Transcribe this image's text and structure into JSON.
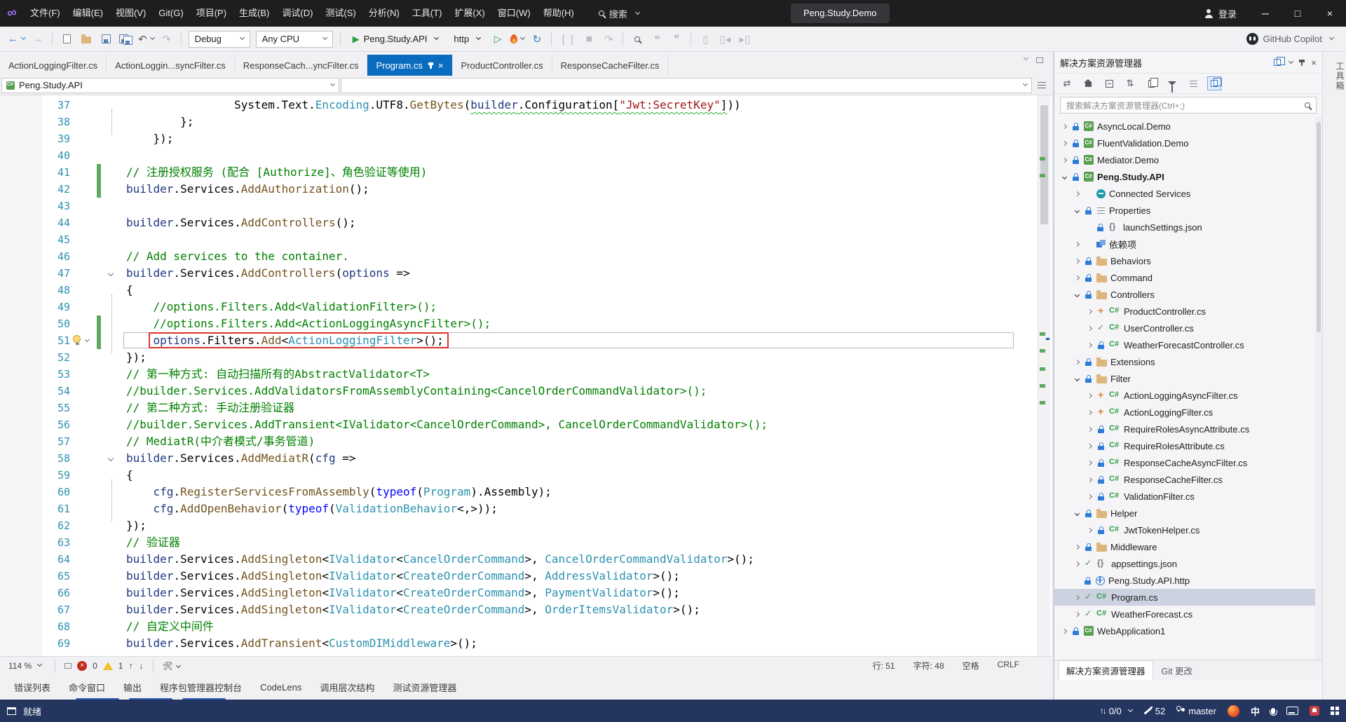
{
  "titlebar": {
    "menus": [
      "文件(F)",
      "编辑(E)",
      "视图(V)",
      "Git(G)",
      "项目(P)",
      "生成(B)",
      "调试(D)",
      "测试(S)",
      "分析(N)",
      "工具(T)",
      "扩展(X)",
      "窗口(W)",
      "帮助(H)"
    ],
    "search_label": "搜索",
    "solution_pill": "Peng.Study.Demo",
    "signin_label": "登录",
    "minimize": "─",
    "maximize": "□",
    "close": "×"
  },
  "toolbar": {
    "config_label": "Debug",
    "platform_label": "Any CPU",
    "run_target": "Peng.Study.API",
    "run_profile": "http",
    "copilot_label": "GitHub Copilot"
  },
  "doc_tabs": [
    {
      "label": "ActionLoggingFilter.cs",
      "active": false
    },
    {
      "label": "ActionLoggin...syncFilter.cs",
      "active": false
    },
    {
      "label": "ResponseCach...yncFilter.cs",
      "active": false
    },
    {
      "label": "Program.cs",
      "active": true
    },
    {
      "label": "ProductController.cs",
      "active": false
    },
    {
      "label": "ResponseCacheFilter.cs",
      "active": false
    }
  ],
  "navbar": {
    "project": "Peng.Study.API"
  },
  "editor": {
    "current_line": 51,
    "change_lines": [
      41,
      42,
      50,
      51
    ],
    "fold_lines": [
      47,
      58
    ],
    "guide_ranges": [
      [
        37,
        39
      ],
      [
        48,
        52
      ],
      [
        59,
        62
      ]
    ],
    "lines": [
      {
        "n": 37,
        "seg": [
          [
            "p",
            "                System.Text."
          ],
          [
            "t",
            "Encoding"
          ],
          [
            "p",
            ".UTF8."
          ],
          [
            "m",
            "GetBytes"
          ],
          [
            "p",
            "("
          ],
          [
            "v sq",
            "builder"
          ],
          [
            "p sq",
            ".Configuration["
          ],
          [
            "s sq",
            "\"Jwt:SecretKey\""
          ],
          [
            "p sq",
            "]"
          ],
          [
            "p",
            "))"
          ]
        ]
      },
      {
        "n": 38,
        "seg": [
          [
            "p",
            "        };"
          ]
        ]
      },
      {
        "n": 39,
        "seg": [
          [
            "p",
            "    });"
          ]
        ]
      },
      {
        "n": 40,
        "seg": []
      },
      {
        "n": 41,
        "seg": [
          [
            "c",
            "// 注册授权服务 (配合 [Authorize]、角色验证等使用)"
          ]
        ]
      },
      {
        "n": 42,
        "seg": [
          [
            "v",
            "builder"
          ],
          [
            "p",
            ".Services."
          ],
          [
            "m",
            "AddAuthorization"
          ],
          [
            "p",
            "();"
          ]
        ]
      },
      {
        "n": 43,
        "seg": []
      },
      {
        "n": 44,
        "seg": [
          [
            "v",
            "builder"
          ],
          [
            "p",
            ".Services."
          ],
          [
            "m",
            "AddControllers"
          ],
          [
            "p",
            "();"
          ]
        ]
      },
      {
        "n": 45,
        "seg": []
      },
      {
        "n": 46,
        "seg": [
          [
            "c",
            "// Add services to the container."
          ]
        ]
      },
      {
        "n": 47,
        "seg": [
          [
            "v",
            "builder"
          ],
          [
            "p",
            ".Services."
          ],
          [
            "m",
            "AddControllers"
          ],
          [
            "p",
            "("
          ],
          [
            "v",
            "options"
          ],
          [
            "p",
            " =>"
          ]
        ]
      },
      {
        "n": 48,
        "seg": [
          [
            "p",
            "{"
          ]
        ]
      },
      {
        "n": 49,
        "seg": [
          [
            "c",
            "    //options.Filters.Add<ValidationFilter>();"
          ]
        ]
      },
      {
        "n": 50,
        "seg": [
          [
            "c",
            "    //options.Filters.Add<ActionLoggingAsyncFilter>();"
          ]
        ]
      },
      {
        "n": 51,
        "seg": [
          [
            "v",
            "    options"
          ],
          [
            "p",
            ".Filters."
          ],
          [
            "m",
            "Add"
          ],
          [
            "p",
            "<"
          ],
          [
            "t",
            "ActionLoggingFilter"
          ],
          [
            "p",
            ">();"
          ]
        ]
      },
      {
        "n": 52,
        "seg": [
          [
            "p",
            "});"
          ]
        ]
      },
      {
        "n": 53,
        "seg": [
          [
            "c",
            "// 第一种方式: 自动扫描所有的AbstractValidator<T>"
          ]
        ]
      },
      {
        "n": 54,
        "seg": [
          [
            "c",
            "//builder.Services.AddValidatorsFromAssemblyContaining<CancelOrderCommandValidator>();"
          ]
        ]
      },
      {
        "n": 55,
        "seg": [
          [
            "c",
            "// 第二种方式: 手动注册验证器"
          ]
        ]
      },
      {
        "n": 56,
        "seg": [
          [
            "c",
            "//builder.Services.AddTransient<IValidator<CancelOrderCommand>, CancelOrderCommandValidator>();"
          ]
        ]
      },
      {
        "n": 57,
        "seg": [
          [
            "c",
            "// MediatR(中介者模式/事务管道)"
          ]
        ]
      },
      {
        "n": 58,
        "seg": [
          [
            "v",
            "builder"
          ],
          [
            "p",
            ".Services."
          ],
          [
            "m",
            "AddMediatR"
          ],
          [
            "p",
            "("
          ],
          [
            "v",
            "cfg"
          ],
          [
            "p",
            " =>"
          ]
        ]
      },
      {
        "n": 59,
        "seg": [
          [
            "p",
            "{"
          ]
        ]
      },
      {
        "n": 60,
        "seg": [
          [
            "v",
            "    cfg"
          ],
          [
            "p",
            "."
          ],
          [
            "m",
            "RegisterServicesFromAssembly"
          ],
          [
            "p",
            "("
          ],
          [
            "k",
            "typeof"
          ],
          [
            "p",
            "("
          ],
          [
            "t",
            "Program"
          ],
          [
            "p",
            ").Assembly);"
          ]
        ]
      },
      {
        "n": 61,
        "seg": [
          [
            "v",
            "    cfg"
          ],
          [
            "p",
            "."
          ],
          [
            "m",
            "AddOpenBehavior"
          ],
          [
            "p",
            "("
          ],
          [
            "k",
            "typeof"
          ],
          [
            "p",
            "("
          ],
          [
            "t",
            "ValidationBehavior"
          ],
          [
            "p",
            "<,>));"
          ]
        ]
      },
      {
        "n": 62,
        "seg": [
          [
            "p",
            "});"
          ]
        ]
      },
      {
        "n": 63,
        "seg": [
          [
            "c",
            "// 验证器"
          ]
        ]
      },
      {
        "n": 64,
        "seg": [
          [
            "v",
            "builder"
          ],
          [
            "p",
            ".Services."
          ],
          [
            "m",
            "AddSingleton"
          ],
          [
            "p",
            "<"
          ],
          [
            "t",
            "IValidator"
          ],
          [
            "p",
            "<"
          ],
          [
            "t",
            "CancelOrderCommand"
          ],
          [
            "p",
            ">, "
          ],
          [
            "t",
            "CancelOrderCommandValidator"
          ],
          [
            "p",
            ">();"
          ]
        ]
      },
      {
        "n": 65,
        "seg": [
          [
            "v",
            "builder"
          ],
          [
            "p",
            ".Services."
          ],
          [
            "m",
            "AddSingleton"
          ],
          [
            "p",
            "<"
          ],
          [
            "t",
            "IValidator"
          ],
          [
            "p",
            "<"
          ],
          [
            "t",
            "CreateOrderCommand"
          ],
          [
            "p",
            ">, "
          ],
          [
            "t",
            "AddressValidator"
          ],
          [
            "p",
            ">();"
          ]
        ]
      },
      {
        "n": 66,
        "seg": [
          [
            "v",
            "builder"
          ],
          [
            "p",
            ".Services."
          ],
          [
            "m",
            "AddSingleton"
          ],
          [
            "p",
            "<"
          ],
          [
            "t",
            "IValidator"
          ],
          [
            "p",
            "<"
          ],
          [
            "t",
            "CreateOrderCommand"
          ],
          [
            "p",
            ">, "
          ],
          [
            "t",
            "PaymentValidator"
          ],
          [
            "p",
            ">();"
          ]
        ]
      },
      {
        "n": 67,
        "seg": [
          [
            "v",
            "builder"
          ],
          [
            "p",
            ".Services."
          ],
          [
            "m",
            "AddSingleton"
          ],
          [
            "p",
            "<"
          ],
          [
            "t",
            "IValidator"
          ],
          [
            "p",
            "<"
          ],
          [
            "t",
            "CreateOrderCommand"
          ],
          [
            "p",
            ">, "
          ],
          [
            "t",
            "OrderItemsValidator"
          ],
          [
            "p",
            ">();"
          ]
        ]
      },
      {
        "n": 68,
        "seg": [
          [
            "c",
            "// 自定义中间件"
          ]
        ]
      },
      {
        "n": 69,
        "seg": [
          [
            "v",
            "builder"
          ],
          [
            "p",
            ".Services."
          ],
          [
            "m",
            "AddTransient"
          ],
          [
            "p",
            "<"
          ],
          [
            "t",
            "CustomDIMiddleware"
          ],
          [
            "p",
            ">();"
          ]
        ]
      }
    ]
  },
  "editor_status": {
    "zoom": "114 %",
    "errors": "0",
    "warnings": "1",
    "line_label": "行: 51",
    "char_label": "字符: 48",
    "spaces_label": "空格",
    "eol_label": "CRLF"
  },
  "panel_tabs": [
    "错误列表",
    "命令窗口",
    "输出",
    "程序包管理器控制台",
    "CodeLens",
    "调用层次结构",
    "测试资源管理器"
  ],
  "solution_explorer": {
    "title": "解决方案资源管理器",
    "search_placeholder": "搜索解决方案资源管理器(Ctrl+;)",
    "rows": [
      {
        "i": 0,
        "a": "c",
        "b": "lock",
        "ic": "project",
        "t": "AsyncLocal.Demo"
      },
      {
        "i": 0,
        "a": "c",
        "b": "lock",
        "ic": "project",
        "t": "FluentValidation.Demo"
      },
      {
        "i": 0,
        "a": "c",
        "b": "lock",
        "ic": "project",
        "t": "Mediator.Demo"
      },
      {
        "i": 0,
        "a": "e",
        "b": "lock",
        "ic": "project",
        "t": "Peng.Study.API",
        "bold": true
      },
      {
        "i": 1,
        "a": "c",
        "b": "",
        "ic": "services",
        "t": "Connected Services"
      },
      {
        "i": 1,
        "a": "e",
        "b": "lock",
        "ic": "props",
        "t": "Properties"
      },
      {
        "i": 2,
        "a": "",
        "b": "lock",
        "ic": "json",
        "t": "launchSettings.json"
      },
      {
        "i": 1,
        "a": "c",
        "b": "",
        "ic": "deps",
        "t": "依赖项"
      },
      {
        "i": 1,
        "a": "c",
        "b": "lock",
        "ic": "folder",
        "t": "Behaviors"
      },
      {
        "i": 1,
        "a": "c",
        "b": "lock",
        "ic": "folder",
        "t": "Command"
      },
      {
        "i": 1,
        "a": "e",
        "b": "lock",
        "ic": "folder",
        "t": "Controllers"
      },
      {
        "i": 2,
        "a": "c",
        "b": "plus",
        "ic": "cs",
        "t": "ProductController.cs"
      },
      {
        "i": 2,
        "a": "c",
        "b": "check",
        "ic": "cs",
        "t": "UserController.cs"
      },
      {
        "i": 2,
        "a": "c",
        "b": "lock",
        "ic": "cs",
        "t": "WeatherForecastController.cs"
      },
      {
        "i": 1,
        "a": "c",
        "b": "lock",
        "ic": "folder",
        "t": "Extensions"
      },
      {
        "i": 1,
        "a": "e",
        "b": "lock",
        "ic": "folder",
        "t": "Filter"
      },
      {
        "i": 2,
        "a": "c",
        "b": "plus",
        "ic": "cs",
        "t": "ActionLoggingAsyncFilter.cs"
      },
      {
        "i": 2,
        "a": "c",
        "b": "plus",
        "ic": "cs",
        "t": "ActionLoggingFilter.cs"
      },
      {
        "i": 2,
        "a": "c",
        "b": "lock",
        "ic": "cs",
        "t": "RequireRolesAsyncAttribute.cs"
      },
      {
        "i": 2,
        "a": "c",
        "b": "lock",
        "ic": "cs",
        "t": "RequireRolesAttribute.cs"
      },
      {
        "i": 2,
        "a": "c",
        "b": "lock",
        "ic": "cs",
        "t": "ResponseCacheAsyncFilter.cs"
      },
      {
        "i": 2,
        "a": "c",
        "b": "lock",
        "ic": "cs",
        "t": "ResponseCacheFilter.cs"
      },
      {
        "i": 2,
        "a": "c",
        "b": "lock",
        "ic": "cs",
        "t": "ValidationFilter.cs"
      },
      {
        "i": 1,
        "a": "e",
        "b": "lock",
        "ic": "folder",
        "t": "Helper"
      },
      {
        "i": 2,
        "a": "c",
        "b": "lock",
        "ic": "cs",
        "t": "JwtTokenHelper.cs"
      },
      {
        "i": 1,
        "a": "c",
        "b": "lock",
        "ic": "folder",
        "t": "Middleware"
      },
      {
        "i": 1,
        "a": "c",
        "b": "check",
        "ic": "json",
        "t": "appsettings.json"
      },
      {
        "i": 1,
        "a": "",
        "b": "lock",
        "ic": "globe",
        "t": "Peng.Study.API.http"
      },
      {
        "i": 1,
        "a": "c",
        "b": "check",
        "ic": "cs",
        "t": "Program.cs",
        "sel": true
      },
      {
        "i": 1,
        "a": "c",
        "b": "check",
        "ic": "cs",
        "t": "WeatherForecast.cs"
      },
      {
        "i": 0,
        "a": "c",
        "b": "lock",
        "ic": "project",
        "t": "WebApplication1"
      }
    ],
    "bottom_tabs": [
      "解决方案资源管理器",
      "Git 更改"
    ]
  },
  "right_strip": {
    "tab_label": "工具箱"
  },
  "status_bar": {
    "ready": "就绪",
    "sync_count": "0/0",
    "edit_count": "52",
    "branch": "master",
    "ime": "中"
  }
}
